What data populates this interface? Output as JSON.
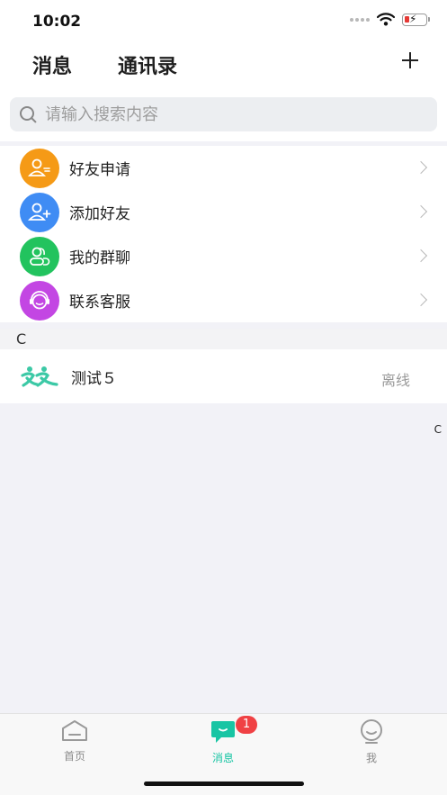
{
  "status_bar": {
    "time": "10:02"
  },
  "header": {
    "tabs": [
      {
        "label": "消息"
      },
      {
        "label": "通讯录"
      }
    ],
    "add_label": "+"
  },
  "search": {
    "placeholder": "请输入搜索内容"
  },
  "menu": {
    "items": [
      {
        "label": "好友申请",
        "icon": "friend-request-icon",
        "color": "#f59a16"
      },
      {
        "label": "添加好友",
        "icon": "add-friend-icon",
        "color": "#3f8cf4"
      },
      {
        "label": "我的群聊",
        "icon": "group-chat-icon",
        "color": "#22c35e"
      },
      {
        "label": "联系客服",
        "icon": "customer-service-icon",
        "color": "#c346e3"
      }
    ]
  },
  "section": {
    "letter": "C"
  },
  "contacts": [
    {
      "name": "测试５",
      "status": "离线",
      "logo": "app-logo-icon"
    }
  ],
  "index": {
    "letter": "C"
  },
  "tabbar": {
    "items": [
      {
        "label": "首页",
        "icon": "home-icon"
      },
      {
        "label": "消息",
        "icon": "message-icon",
        "badge": "1",
        "active": true
      },
      {
        "label": "我",
        "icon": "profile-icon"
      }
    ],
    "accent": "#19c5a4",
    "badge_color": "#f04144"
  }
}
